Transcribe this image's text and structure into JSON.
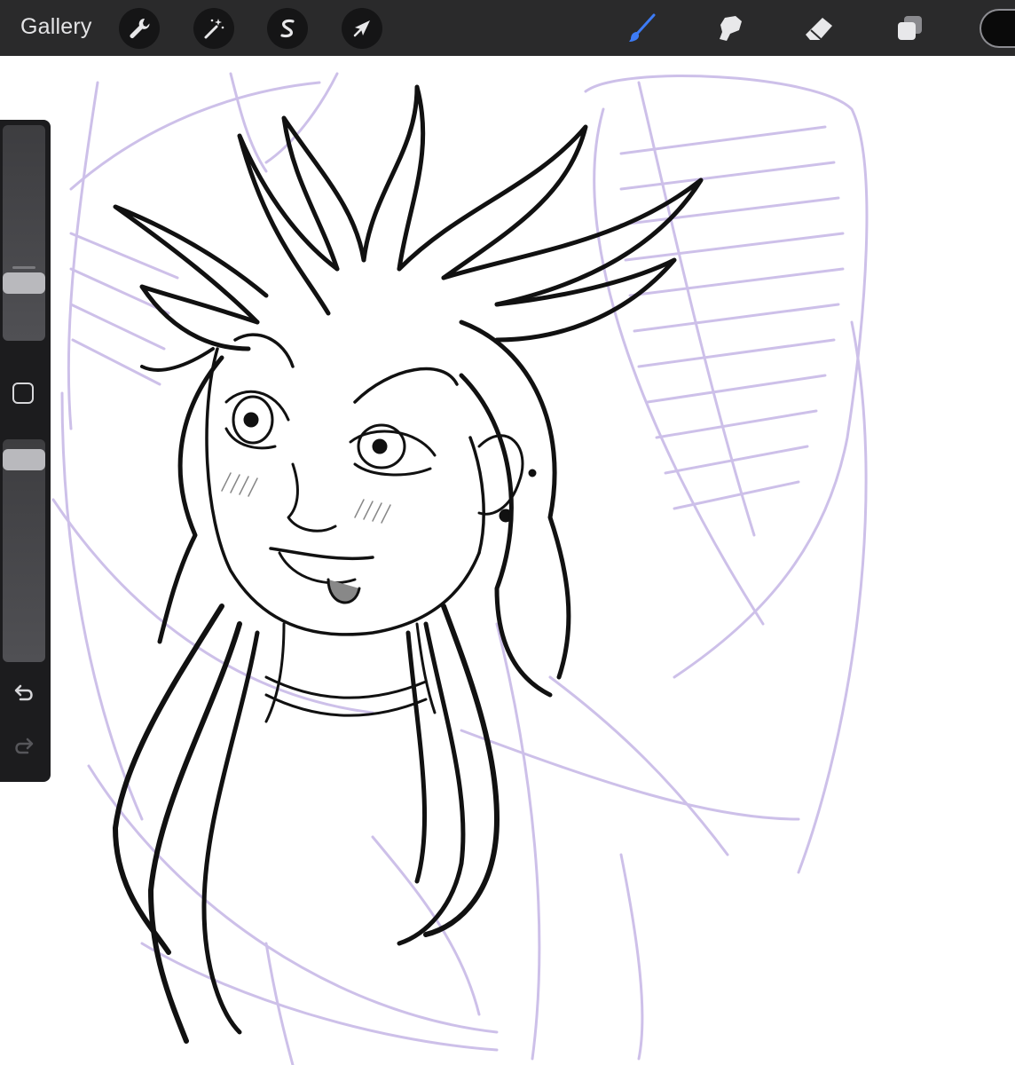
{
  "toolbar": {
    "gallery_label": "Gallery",
    "left_tools": [
      {
        "name": "actions",
        "icon": "wrench-icon"
      },
      {
        "name": "adjustments",
        "icon": "magic-wand-icon"
      },
      {
        "name": "selection",
        "icon": "selection-s-icon"
      },
      {
        "name": "transform",
        "icon": "arrow-cursor-icon"
      }
    ],
    "right_tools": [
      {
        "name": "brush",
        "icon": "brush-icon",
        "active": true
      },
      {
        "name": "smudge",
        "icon": "smudge-finger-icon",
        "active": false
      },
      {
        "name": "eraser",
        "icon": "eraser-icon",
        "active": false
      },
      {
        "name": "layers",
        "icon": "layers-icon",
        "active": false
      }
    ],
    "current_color": "#0a0a0a"
  },
  "sidebar": {
    "brush_size_fraction": 0.24,
    "brush_opacity_fraction": 0.95,
    "icons": [
      "modify-square-icon",
      "undo-icon",
      "redo-icon"
    ]
  },
  "colors": {
    "toolbar_bg": "#2a2a2b",
    "active_tool": "#3d7bf5",
    "sketch_lines": "#cbbde8",
    "ink_lines": "#111111"
  }
}
